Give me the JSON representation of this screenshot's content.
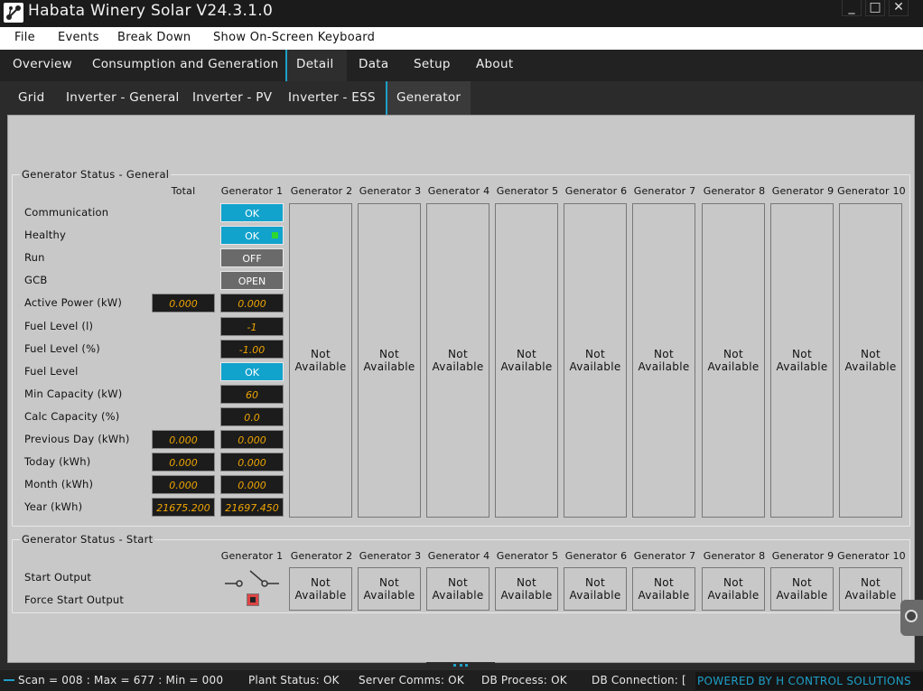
{
  "window": {
    "title": "Habata Winery Solar V24.3.1.0",
    "minimize": "_",
    "maximize": "□",
    "close": "✕"
  },
  "menu": [
    "File",
    "Events",
    "Break Down",
    "Show On-Screen Keyboard"
  ],
  "main_tabs": [
    "Overview",
    "Consumption and Generation",
    "Detail",
    "Data",
    "Setup",
    "About"
  ],
  "main_tab_active": "Detail",
  "sub_tabs": [
    "Grid",
    "Inverter - General",
    "Inverter - PV",
    "Inverter - ESS",
    "Generator"
  ],
  "sub_tab_active": "Generator",
  "general": {
    "title": "Generator Status - General",
    "total_header": "Total",
    "gen_headers": [
      "Generator 1",
      "Generator 2",
      "Generator 3",
      "Generator 4",
      "Generator 5",
      "Generator 6",
      "Generator 7",
      "Generator 8",
      "Generator 9",
      "Generator 10"
    ],
    "rows": [
      {
        "label": "Communication",
        "total": null,
        "g1": "OK",
        "g1_kind": "ok"
      },
      {
        "label": "Healthy",
        "total": null,
        "g1": "OK",
        "g1_kind": "ok"
      },
      {
        "label": "Run",
        "total": null,
        "g1": "OFF",
        "g1_kind": "grey"
      },
      {
        "label": "GCB",
        "total": null,
        "g1": "OPEN",
        "g1_kind": "grey"
      },
      {
        "label": "Active Power (kW)",
        "total": "0.000",
        "g1": "0.000",
        "g1_kind": "val"
      },
      {
        "label": "Fuel Level (l)",
        "total": null,
        "g1": "-1",
        "g1_kind": "val"
      },
      {
        "label": "Fuel Level (%)",
        "total": null,
        "g1": "-1.00",
        "g1_kind": "val"
      },
      {
        "label": "Fuel Level",
        "total": null,
        "g1": "OK",
        "g1_kind": "ok"
      },
      {
        "label": "Min Capacity (kW)",
        "total": null,
        "g1": "60",
        "g1_kind": "val"
      },
      {
        "label": "Calc Capacity (%)",
        "total": null,
        "g1": "0.0",
        "g1_kind": "val"
      },
      {
        "label": "Previous Day (kWh)",
        "total": "0.000",
        "g1": "0.000",
        "g1_kind": "val"
      },
      {
        "label": "Today (kWh)",
        "total": "0.000",
        "g1": "0.000",
        "g1_kind": "val"
      },
      {
        "label": "Month (kWh)",
        "total": "0.000",
        "g1": "0.000",
        "g1_kind": "val"
      },
      {
        "label": "Year (kWh)",
        "total": "21675.200",
        "g1": "21697.450",
        "g1_kind": "val"
      }
    ],
    "not_available": "Not Available"
  },
  "start": {
    "title": "Generator Status - Start",
    "gen_headers": [
      "Generator 1",
      "Generator 2",
      "Generator 3",
      "Generator 4",
      "Generator 5",
      "Generator 6",
      "Generator 7",
      "Generator 8",
      "Generator 9",
      "Generator 10"
    ],
    "rows": [
      "Start Output",
      "Force Start Output"
    ],
    "not_available": "Not Available"
  },
  "status_bar": {
    "scan": "Scan = 008 : Max = 677 : Min = 000",
    "plant": "Plant Status: OK",
    "server": "Server Comms: OK",
    "db_process": "DB Process:  OK",
    "db_connection": "DB Connection:  [",
    "powered": "POWERED BY H CONTROL SOLUTIONS"
  },
  "colors": {
    "accent": "#1ea0c8",
    "ok_fill": "#12a3cc",
    "value_text": "#f0a500",
    "led_green": "#2ed82e"
  }
}
